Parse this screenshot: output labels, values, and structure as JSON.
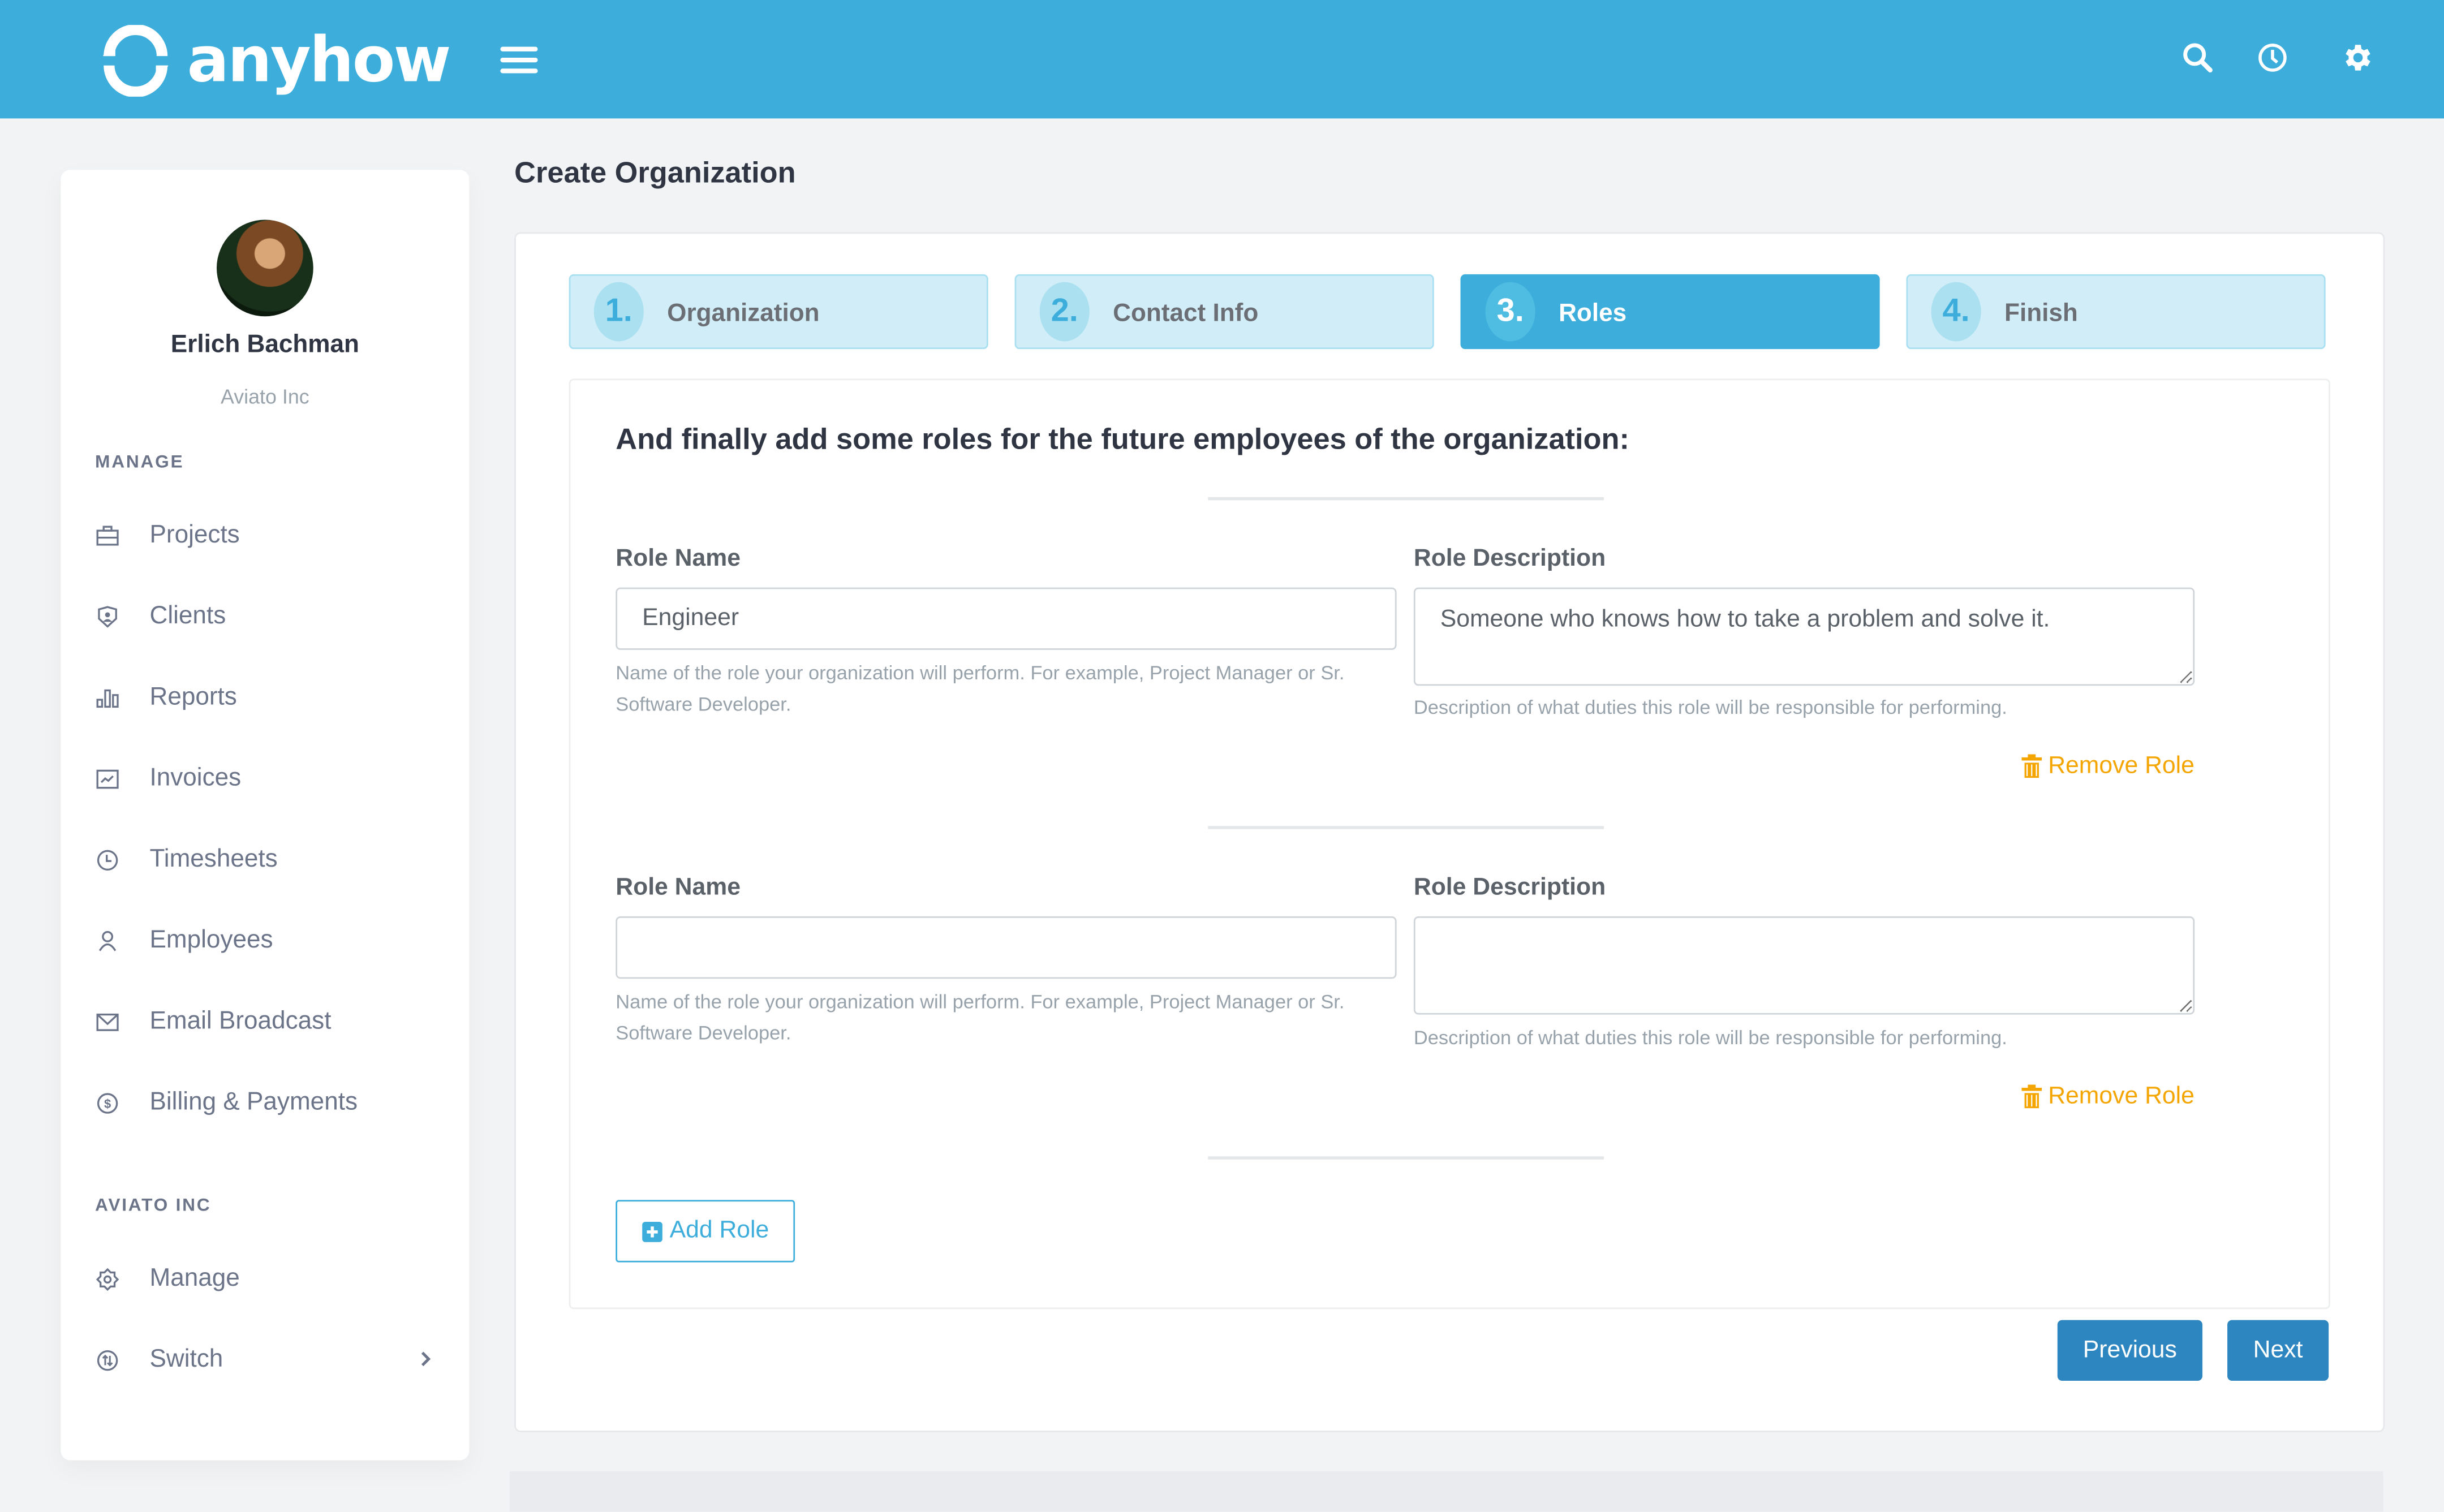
{
  "app": {
    "brand": "anyhow",
    "brand_color": "#3daedb"
  },
  "topbar": {
    "icons": [
      "search-icon",
      "clock-icon",
      "gear-icon"
    ]
  },
  "user": {
    "name": "Erlich Bachman",
    "organization": "Aviato Inc"
  },
  "sidebar": {
    "manage_label": "MANAGE",
    "manage_items": [
      {
        "label": "Projects",
        "icon": "briefcase-icon"
      },
      {
        "label": "Clients",
        "icon": "shield-user-icon"
      },
      {
        "label": "Reports",
        "icon": "bar-chart-icon"
      },
      {
        "label": "Invoices",
        "icon": "trend-chart-icon"
      },
      {
        "label": "Timesheets",
        "icon": "clock-icon"
      },
      {
        "label": "Employees",
        "icon": "user-icon"
      },
      {
        "label": "Email Broadcast",
        "icon": "mail-icon"
      },
      {
        "label": "Billing & Payments",
        "icon": "dollar-icon"
      }
    ],
    "org_label": "AVIATO INC",
    "org_items": [
      {
        "label": "Manage",
        "icon": "settings-icon"
      },
      {
        "label": "Switch",
        "icon": "switch-icon"
      }
    ]
  },
  "page": {
    "title": "Create Organization"
  },
  "wizard": {
    "steps": [
      {
        "number": "1.",
        "label": "Organization",
        "active": false
      },
      {
        "number": "2.",
        "label": "Contact Info",
        "active": false
      },
      {
        "number": "3.",
        "label": "Roles",
        "active": true
      },
      {
        "number": "4.",
        "label": "Finish",
        "active": false
      }
    ],
    "intro": "And finally add some roles for the future employees of the organization:",
    "roles": [
      {
        "name_label": "Role Name",
        "name_value": "Engineer",
        "name_help": "Name of the role your organization will perform. For example, Project Manager or Sr. Software Developer.",
        "desc_label": "Role Description",
        "desc_value": "Someone who knows how to take a problem and solve it.",
        "desc_help": "Description of what duties this role will be responsible for performing.",
        "remove_label": "Remove Role"
      },
      {
        "name_label": "Role Name",
        "name_value": "",
        "name_help": "Name of the role your organization will perform. For example, Project Manager or Sr. Software Developer.",
        "desc_label": "Role Description",
        "desc_value": "",
        "desc_help": "Description of what duties this role will be responsible for performing.",
        "remove_label": "Remove Role"
      }
    ],
    "add_role_label": "Add Role",
    "previous_label": "Previous",
    "next_label": "Next"
  }
}
